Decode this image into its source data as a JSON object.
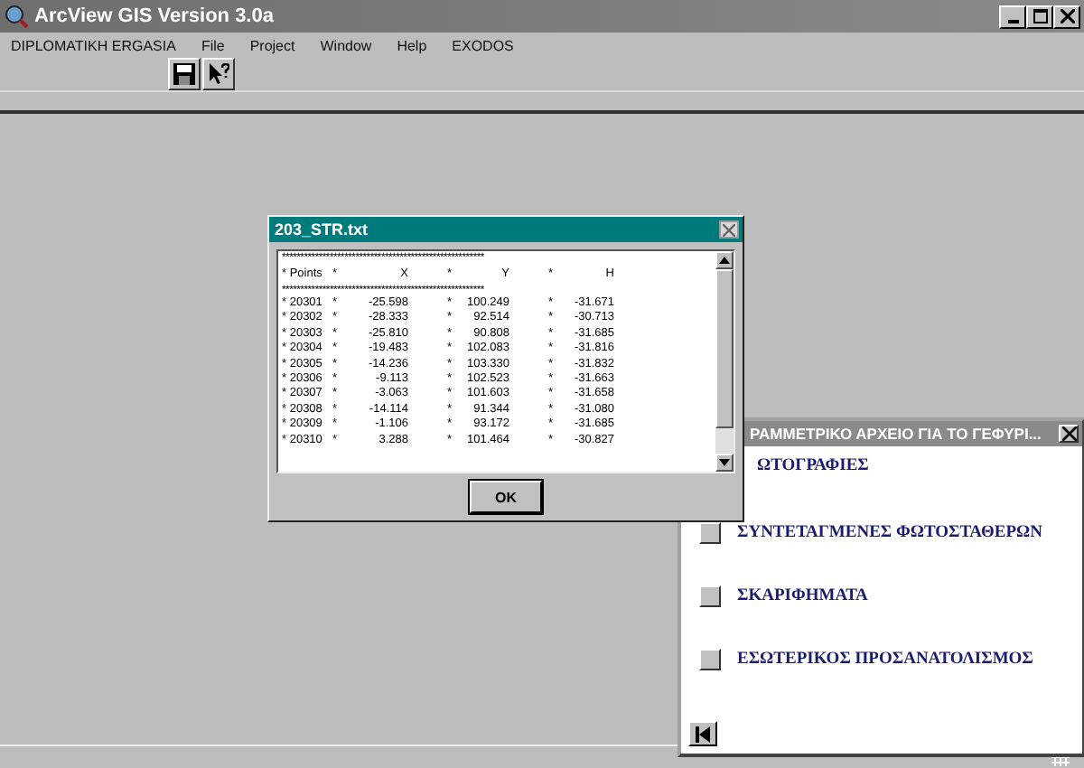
{
  "window": {
    "title": "ArcView GIS Version 3.0a"
  },
  "menu": [
    "DIPLOMATIKH ERGASIA",
    "File",
    "Project",
    "Window",
    "Help",
    "EXODOS"
  ],
  "dialog": {
    "title": "203_STR.txt",
    "separator": "*******************************************************",
    "header": [
      "* Points",
      "*",
      "X",
      "*",
      "Y",
      "*",
      "H"
    ],
    "rows": [
      [
        "* 20301",
        "*",
        "-25.598",
        "*",
        "100.249",
        "*",
        "-31.671"
      ],
      [
        "* 20302",
        "*",
        "-28.333",
        "*",
        "92.514",
        "*",
        "-30.713"
      ],
      [
        "* 20303",
        "*",
        "-25.810",
        "*",
        "90.808",
        "*",
        "-31.685"
      ],
      [
        "* 20304",
        "*",
        "-19.483",
        "*",
        "102.083",
        "*",
        "-31.816"
      ],
      [
        "* 20305",
        "*",
        "-14.236",
        "*",
        "103.330",
        "*",
        "-31.832"
      ],
      [
        "* 20306",
        "*",
        "-9.113",
        "*",
        "102.523",
        "*",
        "-31.663"
      ],
      [
        "* 20307",
        "*",
        "-3.063",
        "*",
        "101.603",
        "*",
        "-31.658"
      ],
      [
        "* 20308",
        "*",
        "-14.114",
        "*",
        "91.344",
        "*",
        "-31.080"
      ],
      [
        "* 20309",
        "*",
        "-1.106",
        "*",
        "93.172",
        "*",
        "-31.685"
      ],
      [
        "* 20310",
        "*",
        "3.288",
        "*",
        "101.464",
        "*",
        "-30.827"
      ]
    ],
    "button": "OK"
  },
  "panel": {
    "title": "ΡΑΜΜΕΤΡΙΚΟ ΑΡΧΕΙΟ ΓΙΑ ΤΟ ΓΕΦΥΡΙ...",
    "items": [
      {
        "label": "ΩΤΟΓΡΑΦΙΕΣ",
        "kind": "covered"
      },
      {
        "label": "ΣΥΝΤΕΤΑΓΜΕΝΕΣ ΦΩΤΟΣΤΑΘΕΡΩΝ",
        "checked": false,
        "kind": "checkbox"
      },
      {
        "label": "ΣΚΑΡΙΦΗΜΑΤΑ",
        "checked": false,
        "kind": "checkbox"
      },
      {
        "label": "ΕΣΩΤΕΡΙΚΟΣ ΠΡΟΣΑΝΑΤΟΛΙΣΜΟΣ",
        "checked": false,
        "kind": "checkbox"
      }
    ]
  }
}
